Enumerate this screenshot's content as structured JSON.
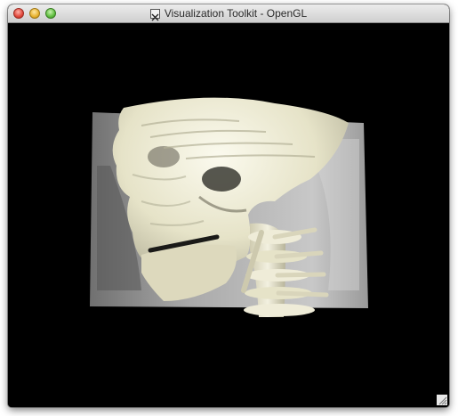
{
  "window": {
    "title": "Visualization Toolkit - OpenGL",
    "title_icon": "x11-icon",
    "buttons": [
      "close-button",
      "minimize-button",
      "zoom-button"
    ]
  },
  "viewport": {
    "background": "#000000",
    "content": "3D volume rendering of a CT scan showing skull and cervical spine",
    "bone_color": "#e8e6cf",
    "tissue_color": "#b8b8b8"
  }
}
